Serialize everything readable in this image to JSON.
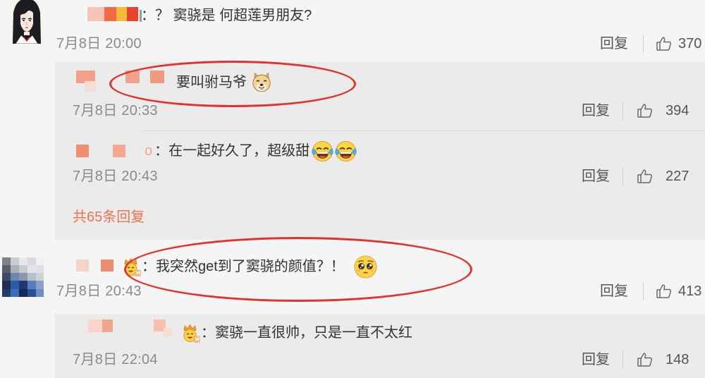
{
  "colors": {
    "accent": "#eb7350",
    "annotation": "#e2322b"
  },
  "icons": {
    "like": "thumbs-up-icon",
    "badge": "crown-face-badge-icon"
  },
  "comments": [
    {
      "text": "：？ 窦骁是 何超莲男朋友?",
      "time": "7月8日 20:00",
      "reply_label": "回复",
      "likes": "370",
      "replies": [
        {
          "text": "要叫驸马爷",
          "emoji": [
            "doge"
          ],
          "circled": true,
          "time": "7月8日 20:33",
          "reply_label": "回复",
          "likes": "394"
        },
        {
          "name_fragment": "o",
          "text": "：在一起好久了，超级甜",
          "emoji": [
            "laugh-cry",
            "laugh-cry"
          ],
          "time": "7月8日 20:43",
          "reply_label": "回复",
          "likes": "227"
        }
      ],
      "more_replies": "共65条回复"
    },
    {
      "badge": "crown-face-badge",
      "text": "：我突然get到了窦骁的颜值？！",
      "emoji": [
        "pleading-face"
      ],
      "circled": true,
      "time": "7月8日 20:43",
      "reply_label": "回复",
      "likes": "413",
      "replies": [
        {
          "badge": "crown-face-badge",
          "text": "：窦骁一直很帅，只是一直不太红",
          "time": "7月8日 22:04",
          "reply_label": "回复",
          "likes": "148"
        }
      ]
    }
  ]
}
